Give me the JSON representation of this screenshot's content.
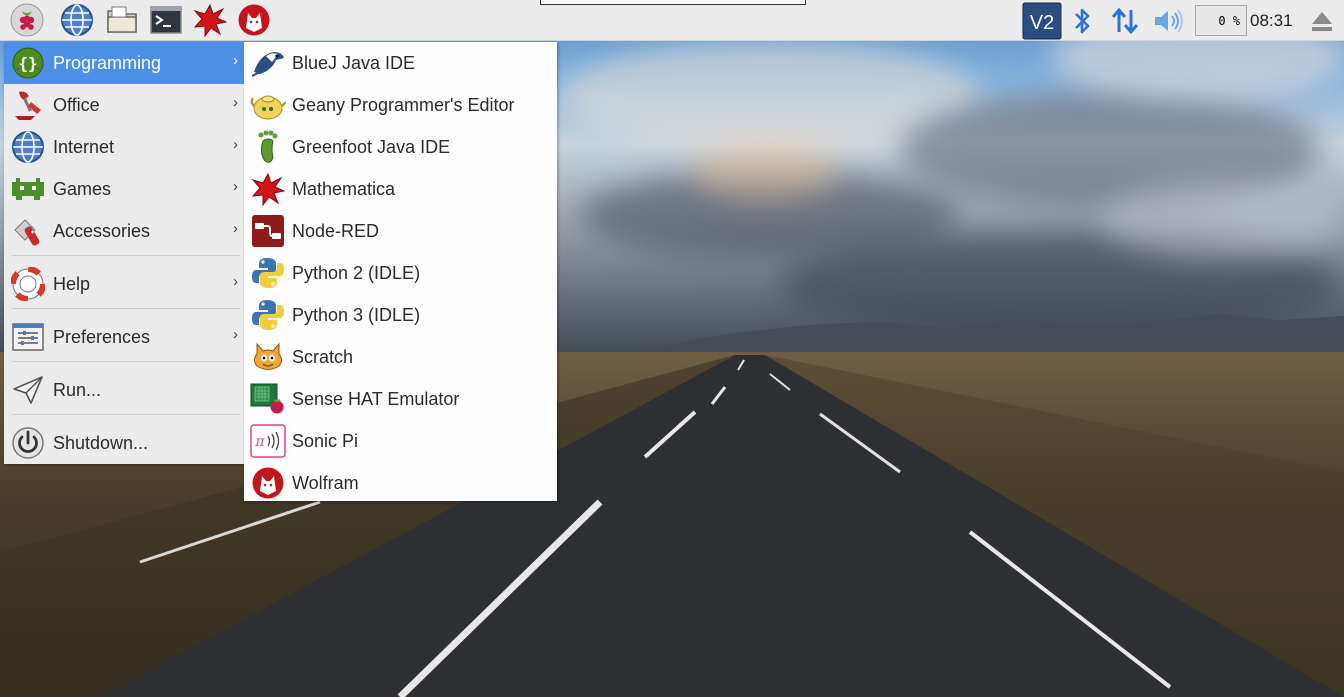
{
  "panel": {
    "launchers": [
      {
        "icon": "raspberry-menu-icon"
      },
      {
        "icon": "web-browser-icon"
      },
      {
        "icon": "file-manager-icon"
      },
      {
        "icon": "terminal-icon"
      },
      {
        "icon": "mathematica-icon"
      },
      {
        "icon": "wolfram-icon"
      }
    ],
    "tray": {
      "vnc_icon": "vnc-icon",
      "bluetooth_icon": "bluetooth-icon",
      "network_icon": "network-icon",
      "volume_icon": "volume-icon",
      "cpu_usage": "0 %",
      "clock": "08:31",
      "eject_icon": "eject-icon"
    }
  },
  "menu": {
    "items": [
      {
        "label": "Programming",
        "icon": "programming-icon",
        "has_submenu": true,
        "active": true
      },
      {
        "label": "Office",
        "icon": "office-icon",
        "has_submenu": true
      },
      {
        "label": "Internet",
        "icon": "internet-icon",
        "has_submenu": true
      },
      {
        "label": "Games",
        "icon": "games-icon",
        "has_submenu": true
      },
      {
        "label": "Accessories",
        "icon": "accessories-icon",
        "has_submenu": true
      },
      {
        "label": "Help",
        "icon": "help-icon",
        "has_submenu": true
      },
      {
        "label": "Preferences",
        "icon": "preferences-icon",
        "has_submenu": true
      },
      {
        "label": "Run...",
        "icon": "run-icon",
        "has_submenu": false
      },
      {
        "label": "Shutdown...",
        "icon": "shutdown-icon",
        "has_submenu": false
      }
    ],
    "arrow": "›"
  },
  "submenu": {
    "items": [
      {
        "label": "BlueJ Java IDE",
        "icon": "bluej-icon"
      },
      {
        "label": "Geany Programmer's Editor",
        "icon": "geany-icon"
      },
      {
        "label": "Greenfoot Java IDE",
        "icon": "greenfoot-icon"
      },
      {
        "label": "Mathematica",
        "icon": "mathematica-icon"
      },
      {
        "label": "Node-RED",
        "icon": "node-red-icon"
      },
      {
        "label": "Python 2 (IDLE)",
        "icon": "python-icon"
      },
      {
        "label": "Python 3 (IDLE)",
        "icon": "python-icon"
      },
      {
        "label": "Scratch",
        "icon": "scratch-icon"
      },
      {
        "label": "Sense HAT Emulator",
        "icon": "sense-hat-icon"
      },
      {
        "label": "Sonic Pi",
        "icon": "sonic-pi-icon"
      },
      {
        "label": "Wolfram",
        "icon": "wolfram-icon"
      }
    ]
  },
  "colors": {
    "menu_highlight": "#4d8fe6",
    "panel_bg": "#ececec",
    "menu_bg": "#ececec",
    "submenu_bg": "#fdfdfd"
  }
}
